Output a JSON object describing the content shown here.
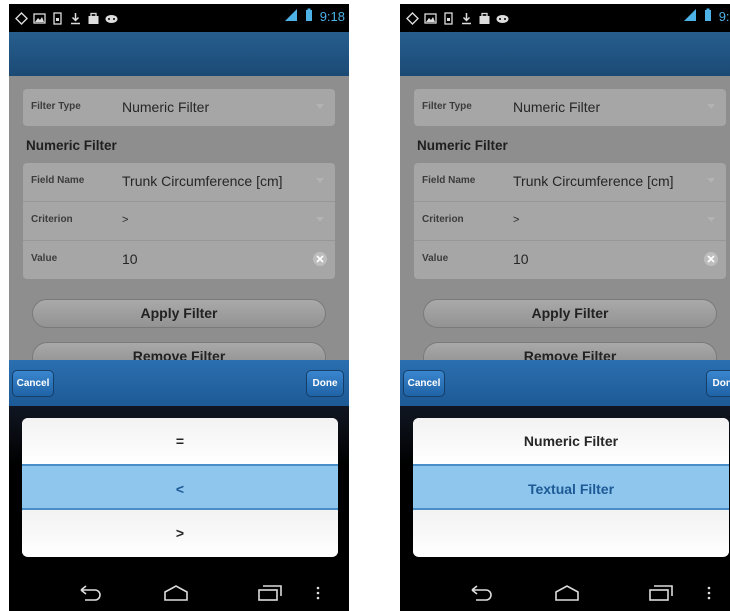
{
  "statusbar": {
    "time": "9:18"
  },
  "left": {
    "filter_type_label": "Filter Type",
    "filter_type_value": "Numeric Filter",
    "section_title": "Numeric Filter",
    "field_name_label": "Field Name",
    "field_name_value": "Trunk Circumference [cm]",
    "criterion_label": "Criterion",
    "criterion_value": ">",
    "value_label": "Value",
    "value_value": "10",
    "apply_button": "Apply Filter",
    "remove_button": "Remove Filter",
    "cancel_button": "Cancel",
    "done_button": "Done",
    "picker_options": [
      "=",
      "<",
      ">"
    ],
    "picker_selected": "<"
  },
  "right": {
    "filter_type_label": "Filter Type",
    "filter_type_value": "Numeric Filter",
    "section_title": "Numeric Filter",
    "field_name_label": "Field Name",
    "field_name_value": "Trunk Circumference [cm]",
    "criterion_label": "Criterion",
    "criterion_value": ">",
    "value_label": "Value",
    "value_value": "10",
    "apply_button": "Apply Filter",
    "remove_button": "Remove Filter",
    "cancel_button": "Cancel",
    "done_button": "Done",
    "picker_options": [
      "Numeric Filter",
      "Textual Filter",
      ""
    ],
    "picker_selected": "Textual Filter"
  },
  "colors": {
    "accent": "#1d5a96",
    "selected_row": "#8fc6ed",
    "status_icon": "#4db2e6"
  },
  "icons": [
    "notification-icon",
    "image-icon",
    "sim-icon",
    "download-icon",
    "bag-icon",
    "gamepad-icon",
    "signal-icon",
    "battery-icon",
    "back-icon",
    "home-icon",
    "recent-apps-icon",
    "menu-icon",
    "clear-icon",
    "dropdown-arrow-icon"
  ]
}
